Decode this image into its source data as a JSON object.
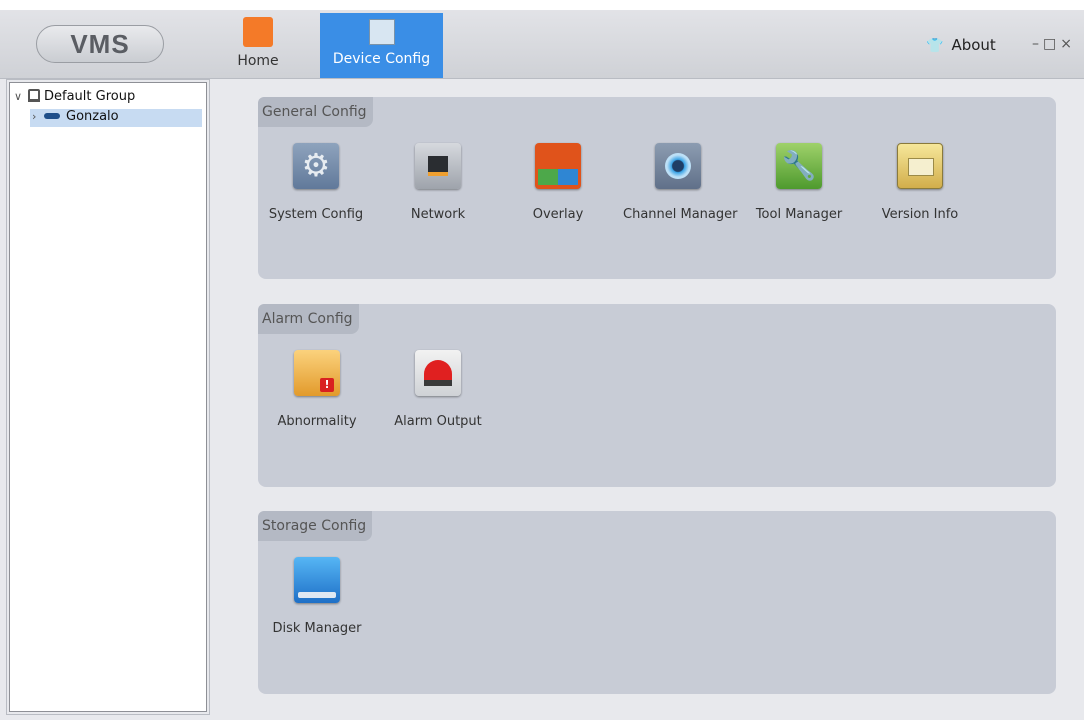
{
  "app": {
    "logo": "VMS"
  },
  "tabs": [
    {
      "label": "Home",
      "icon": "home-icon"
    },
    {
      "label": "Device Config",
      "icon": "device-config-icon",
      "active": true
    }
  ],
  "header": {
    "about_label": "About",
    "about_icon": "shirt-icon",
    "window_controls": "–□×"
  },
  "tree": {
    "root_label": "Default Group",
    "child_label": "Gonzalo"
  },
  "sections": {
    "general": {
      "title": "General Config",
      "items": [
        {
          "label": "System Config",
          "icon": "gear-icon"
        },
        {
          "label": "Network",
          "icon": "network-icon"
        },
        {
          "label": "Overlay",
          "icon": "overlay-icon"
        },
        {
          "label": "Channel Manager",
          "icon": "camera-lens-icon"
        },
        {
          "label": "Tool Manager",
          "icon": "wrench-icon"
        },
        {
          "label": "Version Info",
          "icon": "version-info-icon"
        }
      ]
    },
    "alarm": {
      "title": "Alarm Config",
      "items": [
        {
          "label": "Abnormality",
          "icon": "abnormality-icon"
        },
        {
          "label": "Alarm Output",
          "icon": "alarm-light-icon"
        }
      ]
    },
    "storage": {
      "title": "Storage Config",
      "items": [
        {
          "label": "Disk Manager",
          "icon": "disk-icon"
        }
      ]
    }
  },
  "colors": {
    "accent": "#3a8ee6",
    "panel": "#c8ccd6",
    "background": "#e8e9ed"
  }
}
